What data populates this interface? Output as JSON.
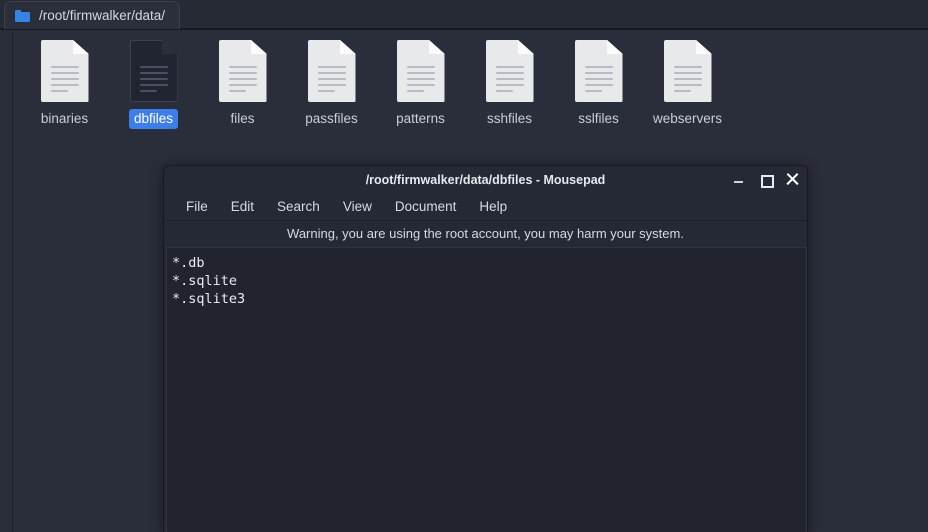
{
  "file_manager": {
    "path_bar": {
      "icon": "folder-icon",
      "path": "/root/firmwalker/data/"
    },
    "files": [
      {
        "name": "binaries",
        "icon": "document-icon",
        "selected": false
      },
      {
        "name": "dbfiles",
        "icon": "document-icon",
        "selected": true
      },
      {
        "name": "files",
        "icon": "document-icon",
        "selected": false
      },
      {
        "name": "passfiles",
        "icon": "document-icon",
        "selected": false
      },
      {
        "name": "patterns",
        "icon": "document-icon",
        "selected": false
      },
      {
        "name": "sshfiles",
        "icon": "document-icon",
        "selected": false
      },
      {
        "name": "sslfiles",
        "icon": "document-icon",
        "selected": false
      },
      {
        "name": "webservers",
        "icon": "document-icon",
        "selected": false
      }
    ]
  },
  "mousepad": {
    "title": "/root/firmwalker/data/dbfiles - Mousepad",
    "window_buttons": {
      "minimize": "minimize-icon",
      "maximize": "maximize-icon",
      "close": "close-icon"
    },
    "menu": [
      {
        "label": "File"
      },
      {
        "label": "Edit"
      },
      {
        "label": "Search"
      },
      {
        "label": "View"
      },
      {
        "label": "Document"
      },
      {
        "label": "Help"
      }
    ],
    "warning": "Warning, you are using the root account, you may harm your system.",
    "document_lines": [
      "*.db",
      "*.sqlite",
      "*.sqlite3"
    ]
  },
  "colors": {
    "desktop_background": "#2a2e3a",
    "window_chrome": "#252935",
    "text_area_background": "#21242f",
    "selection_blue": "#3d7ee8",
    "folder_icon_blue": "#3584e4",
    "text_primary": "#e5e8ee"
  }
}
